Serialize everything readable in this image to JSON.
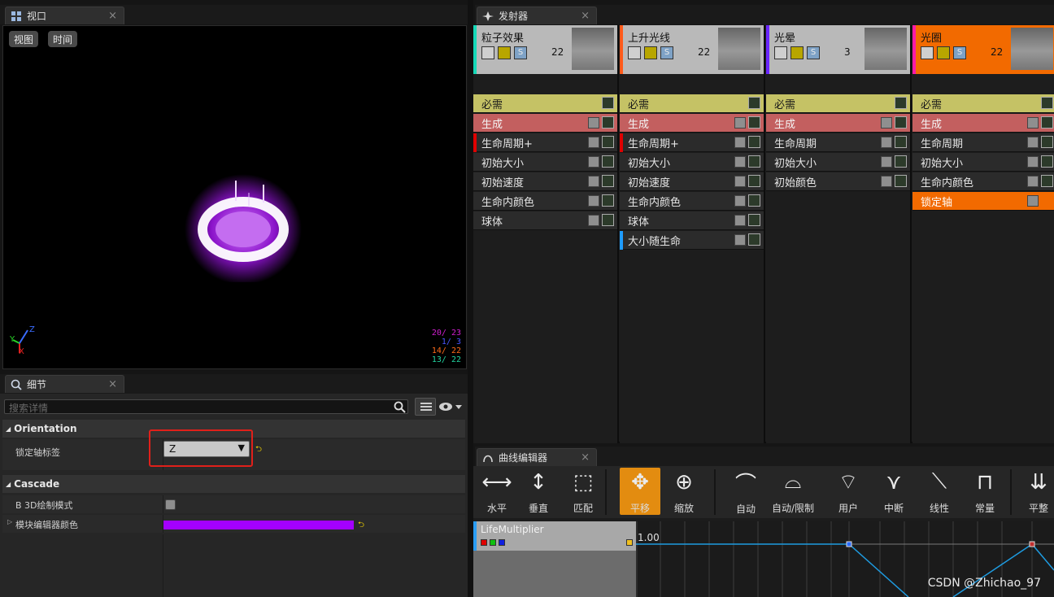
{
  "tabs": {
    "viewport": "视口",
    "emitters": "发射器",
    "details": "细节",
    "curve_editor": "曲线编辑器",
    "close": "×"
  },
  "viewport": {
    "view_btn": "视图",
    "time_btn": "时间",
    "stats": [
      {
        "text": "20/ 23",
        "color": "#d21fd2"
      },
      {
        "text": "1/ 3",
        "color": "#4a55ff"
      },
      {
        "text": "14/ 22",
        "color": "#ff6b1a"
      },
      {
        "text": "13/ 22",
        "color": "#22d3a0"
      }
    ],
    "axes": {
      "x": "X",
      "y": "Y",
      "z": "Z"
    }
  },
  "details": {
    "search_placeholder": "搜索详情",
    "sections": {
      "orientation": "Orientation",
      "cascade": "Cascade"
    },
    "props": {
      "lock_axis_label": "锁定轴标签",
      "lock_axis_value": "Z",
      "b3d_label": "B 3D绘制模式",
      "module_color_label": "模块编辑器颜色"
    },
    "module_color": "#a400ff"
  },
  "emitters": [
    {
      "title": "粒子效果",
      "count": "22",
      "color": "#16d9b8",
      "modules": [
        {
          "label": "必需",
          "kind": "req"
        },
        {
          "label": "生成",
          "kind": "spawn"
        },
        {
          "label": "生命周期+",
          "kind": "normal",
          "mark": "#e00000"
        },
        {
          "label": "初始大小",
          "kind": "normal"
        },
        {
          "label": "初始速度",
          "kind": "normal"
        },
        {
          "label": "生命内颜色",
          "kind": "normal"
        },
        {
          "label": "球体",
          "kind": "normal"
        }
      ]
    },
    {
      "title": "上升光线",
      "count": "22",
      "color": "#ff5a1a",
      "modules": [
        {
          "label": "必需",
          "kind": "req"
        },
        {
          "label": "生成",
          "kind": "spawn"
        },
        {
          "label": "生命周期+",
          "kind": "normal",
          "mark": "#e00000"
        },
        {
          "label": "初始大小",
          "kind": "normal"
        },
        {
          "label": "初始速度",
          "kind": "normal"
        },
        {
          "label": "生命内颜色",
          "kind": "normal"
        },
        {
          "label": "球体",
          "kind": "normal"
        },
        {
          "label": "大小随生命",
          "kind": "normal",
          "mark": "#1e9bff"
        }
      ]
    },
    {
      "title": "光晕",
      "count": "3",
      "color": "#6a26ff",
      "modules": [
        {
          "label": "必需",
          "kind": "req"
        },
        {
          "label": "生成",
          "kind": "spawn"
        },
        {
          "label": "生命周期",
          "kind": "normal"
        },
        {
          "label": "初始大小",
          "kind": "normal"
        },
        {
          "label": "初始颜色",
          "kind": "normal"
        }
      ]
    },
    {
      "title": "光圈",
      "count": "22",
      "color": "#ff1aa8",
      "head_bg": "#f26a00",
      "modules": [
        {
          "label": "必需",
          "kind": "req"
        },
        {
          "label": "生成",
          "kind": "spawn"
        },
        {
          "label": "生命周期",
          "kind": "normal"
        },
        {
          "label": "初始大小",
          "kind": "normal"
        },
        {
          "label": "生命内颜色",
          "kind": "normal"
        },
        {
          "label": "锁定轴",
          "kind": "hl"
        }
      ]
    }
  ],
  "curve_editor": {
    "tools": [
      {
        "label": "水平",
        "icon": "fit-horizontal-icon",
        "glyph": "⟷"
      },
      {
        "label": "垂直",
        "icon": "fit-vertical-icon",
        "glyph": "↕"
      },
      {
        "label": "匹配",
        "icon": "fit-icon",
        "glyph": "⬚"
      },
      {
        "label": "平移",
        "icon": "pan-icon",
        "glyph": "✥",
        "active": true
      },
      {
        "label": "缩放",
        "icon": "zoom-icon",
        "glyph": "⊕"
      },
      {
        "label": "自动",
        "icon": "auto-tangent-icon",
        "glyph": "⌒"
      },
      {
        "label": "自动/限制",
        "icon": "auto-clamped-icon",
        "glyph": "⌓"
      },
      {
        "label": "用户",
        "icon": "user-tangent-icon",
        "glyph": "⌔"
      },
      {
        "label": "中断",
        "icon": "break-tangent-icon",
        "glyph": "⋎"
      },
      {
        "label": "线性",
        "icon": "linear-icon",
        "glyph": "⟍"
      },
      {
        "label": "常量",
        "icon": "constant-icon",
        "glyph": "⊓"
      },
      {
        "label": "平整",
        "icon": "flatten-icon",
        "glyph": "⇊"
      }
    ],
    "curve_name": "LifeMultiplier",
    "value_label": "1.00"
  },
  "watermark": "CSDN @Zhichao_97"
}
